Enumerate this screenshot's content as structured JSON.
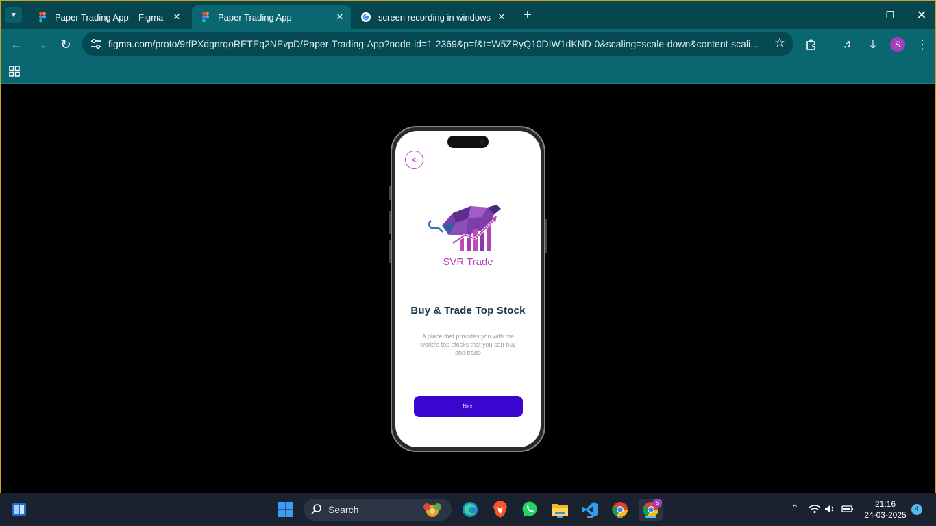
{
  "browser": {
    "tabs": [
      {
        "title": "Paper Trading App – Figma",
        "active": false
      },
      {
        "title": "Paper Trading App",
        "active": true
      },
      {
        "title": "screen recording in windows - G",
        "active": false
      }
    ],
    "url_domain": "figma.com",
    "url_path": "/proto/9rfPXdgnrqoRETEq2NEvpD/Paper-Trading-App?node-id=1-2369&p=f&t=W5ZRyQ10DIW1dKND-0&scaling=scale-down&content-scali...",
    "profile_initial": "S",
    "frame_color": "#0a6670"
  },
  "app": {
    "back_label": "<",
    "brand_name": "SVR Trade",
    "headline": "Buy & Trade Top Stock",
    "description": "A place that provides you with the world's top stocks that you can buy and trade",
    "next_label": "Next",
    "accent_color": "#3a05cf",
    "brand_color": "#b23fb8"
  },
  "taskbar": {
    "search_label": "Search",
    "chrome_profile_badge": "S",
    "time": "21:16",
    "date": "24-03-2025",
    "notification_count": "4"
  }
}
